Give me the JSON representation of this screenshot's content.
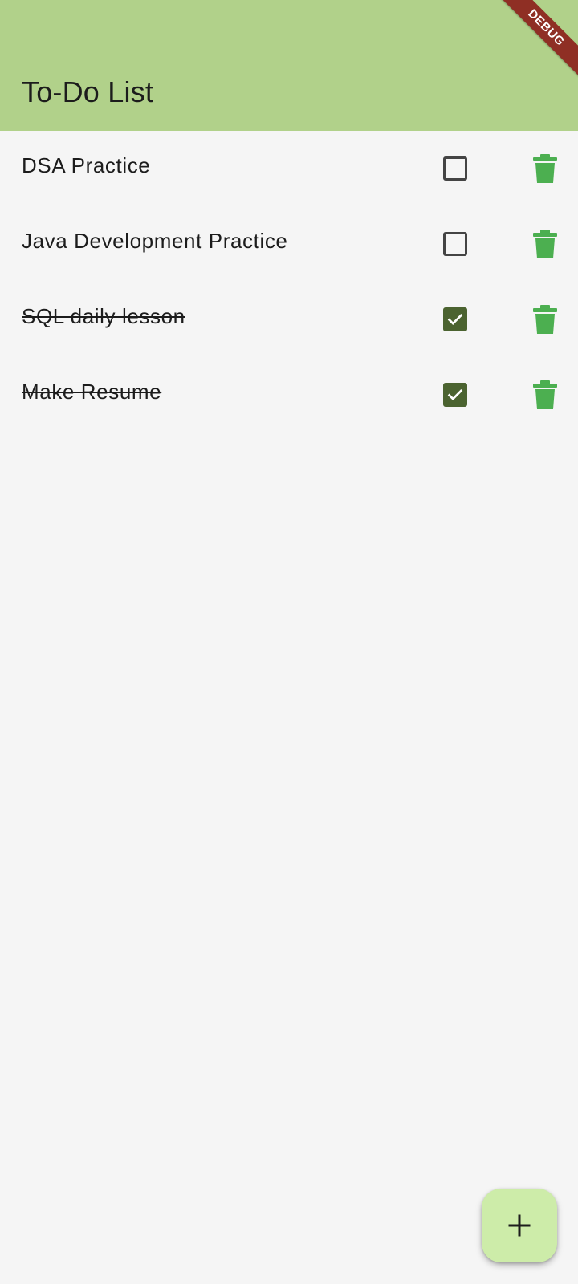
{
  "app_bar": {
    "title": "To-Do List"
  },
  "debug_banner": {
    "label": "DEBUG"
  },
  "todos": [
    {
      "text": "DSA Practice",
      "completed": false
    },
    {
      "text": "Java Development Practice",
      "completed": false
    },
    {
      "text": "SQL daily lesson",
      "completed": true
    },
    {
      "text": "Make Resume",
      "completed": true
    }
  ],
  "icons": {
    "checkbox": "checkbox-icon",
    "delete": "trash-icon",
    "add": "plus-icon"
  },
  "colors": {
    "app_bar": "#b1d18a",
    "background": "#f5f5f5",
    "checked": "#4b6330",
    "delete": "#4caf50",
    "fab": "#cdeca9",
    "debug_ribbon": "#8f2f24"
  }
}
